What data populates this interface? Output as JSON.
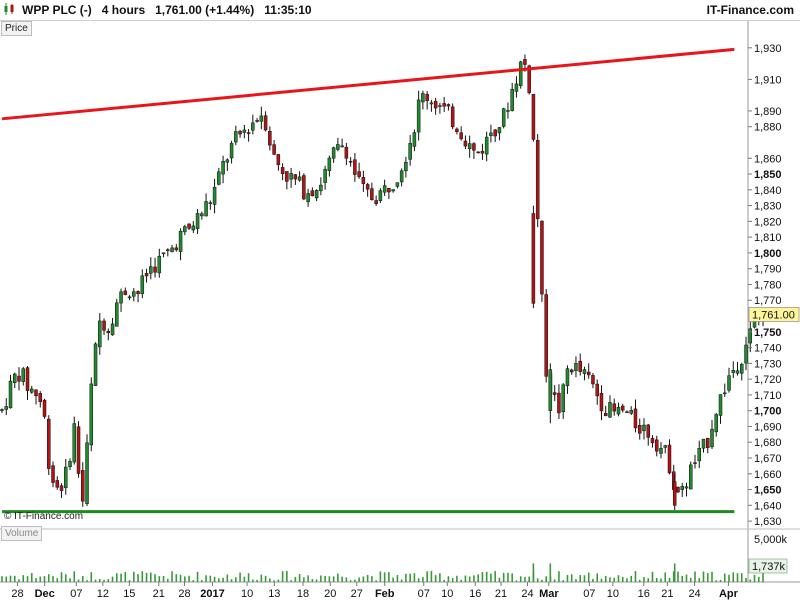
{
  "header": {
    "title": "WPP PLC (-)   4 hours   1,761.00 (+1.44%)   11:35:10",
    "brand": "IT-Finance.com"
  },
  "panels": {
    "price_label": "Price",
    "volume_label": "Volume",
    "watermark": "© IT-Finance.com"
  },
  "colors": {
    "up": "#1f8a2e",
    "down": "#b01515",
    "resistance": "#e8161a",
    "support": "#1f8a1f",
    "volume": "#3a9a3a",
    "last_tag_bg": "#fff59a"
  },
  "chart_data": {
    "type": "candlestick",
    "title": "WPP PLC (-)",
    "timeframe": "4 hours",
    "last_price": "1,761.00",
    "change": "+1.44%",
    "time": "11:35:10",
    "y_range": [
      1625,
      1947
    ],
    "y_ticks": [
      {
        "value": 1930,
        "label": "1,930",
        "bold": false
      },
      {
        "value": 1910,
        "label": "1,910",
        "bold": false
      },
      {
        "value": 1890,
        "label": "1,890",
        "bold": false
      },
      {
        "value": 1880,
        "label": "1,880",
        "bold": false
      },
      {
        "value": 1860,
        "label": "1,860",
        "bold": false
      },
      {
        "value": 1850,
        "label": "1,850",
        "bold": true
      },
      {
        "value": 1840,
        "label": "1,840",
        "bold": false
      },
      {
        "value": 1830,
        "label": "1,830",
        "bold": false
      },
      {
        "value": 1820,
        "label": "1,820",
        "bold": false
      },
      {
        "value": 1810,
        "label": "1,810",
        "bold": false
      },
      {
        "value": 1800,
        "label": "1,800",
        "bold": true
      },
      {
        "value": 1790,
        "label": "1,790",
        "bold": false
      },
      {
        "value": 1780,
        "label": "1,780",
        "bold": false
      },
      {
        "value": 1770,
        "label": "1,770",
        "bold": false
      },
      {
        "value": 1750,
        "label": "1,750",
        "bold": true
      },
      {
        "value": 1740,
        "label": "1,740",
        "bold": false
      },
      {
        "value": 1730,
        "label": "1,730",
        "bold": false
      },
      {
        "value": 1720,
        "label": "1,720",
        "bold": false
      },
      {
        "value": 1710,
        "label": "1,710",
        "bold": false
      },
      {
        "value": 1700,
        "label": "1,700",
        "bold": true
      },
      {
        "value": 1690,
        "label": "1,690",
        "bold": false
      },
      {
        "value": 1680,
        "label": "1,680",
        "bold": false
      },
      {
        "value": 1670,
        "label": "1,670",
        "bold": false
      },
      {
        "value": 1660,
        "label": "1,660",
        "bold": false
      },
      {
        "value": 1650,
        "label": "1,650",
        "bold": true
      },
      {
        "value": 1640,
        "label": "1,640",
        "bold": false
      },
      {
        "value": 1630,
        "label": "1,630",
        "bold": false
      }
    ],
    "last_price_tag": {
      "value": 1761,
      "label": "1,761.00"
    },
    "x_ticks": [
      {
        "label": "28",
        "bold": false
      },
      {
        "label": "Dec",
        "bold": true
      },
      {
        "label": "07",
        "bold": false
      },
      {
        "label": "12",
        "bold": false
      },
      {
        "label": "15",
        "bold": false
      },
      {
        "label": "21",
        "bold": false
      },
      {
        "label": "28",
        "bold": false
      },
      {
        "label": "2017",
        "bold": true
      },
      {
        "label": "10",
        "bold": false
      },
      {
        "label": "13",
        "bold": false
      },
      {
        "label": "18",
        "bold": false
      },
      {
        "label": "20",
        "bold": false
      },
      {
        "label": "27",
        "bold": false
      },
      {
        "label": "Feb",
        "bold": true
      },
      {
        "label": "07",
        "bold": false
      },
      {
        "label": "10",
        "bold": false
      },
      {
        "label": "16",
        "bold": false
      },
      {
        "label": "21",
        "bold": false
      },
      {
        "label": "24",
        "bold": false
      },
      {
        "label": "Mar",
        "bold": true
      },
      {
        "label": "07",
        "bold": false
      },
      {
        "label": "10",
        "bold": false
      },
      {
        "label": "16",
        "bold": false
      },
      {
        "label": "21",
        "bold": false
      },
      {
        "label": "24",
        "bold": false
      },
      {
        "label": "Apr",
        "bold": true
      }
    ],
    "x_tick_positions": [
      0.021,
      0.058,
      0.101,
      0.137,
      0.173,
      0.213,
      0.248,
      0.286,
      0.333,
      0.37,
      0.409,
      0.446,
      0.482,
      0.52,
      0.573,
      0.605,
      0.643,
      0.678,
      0.714,
      0.743,
      0.798,
      0.83,
      0.872,
      0.904,
      0.941,
      0.987
    ],
    "trendlines": [
      {
        "name": "resistance",
        "start": {
          "x": 0,
          "y": 1885
        },
        "end": {
          "x": 0.995,
          "y": 1929
        }
      },
      {
        "name": "support",
        "start": {
          "x": 0,
          "y": 1636
        },
        "end": {
          "x": 0.995,
          "y": 1636
        }
      }
    ],
    "volume": {
      "axis_labels": [
        "5,000k",
        "1,737k"
      ],
      "max_k": 10000,
      "last_k": 1737
    },
    "path_anchors": [
      [
        0.0,
        1700
      ],
      [
        0.015,
        1720
      ],
      [
        0.025,
        1725
      ],
      [
        0.035,
        1715
      ],
      [
        0.05,
        1710
      ],
      [
        0.06,
        1690
      ],
      [
        0.065,
        1660
      ],
      [
        0.075,
        1652
      ],
      [
        0.085,
        1655
      ],
      [
        0.095,
        1680
      ],
      [
        0.1,
        1695
      ],
      [
        0.106,
        1645
      ],
      [
        0.112,
        1642
      ],
      [
        0.118,
        1700
      ],
      [
        0.126,
        1735
      ],
      [
        0.134,
        1760
      ],
      [
        0.144,
        1752
      ],
      [
        0.155,
        1768
      ],
      [
        0.17,
        1778
      ],
      [
        0.185,
        1775
      ],
      [
        0.2,
        1790
      ],
      [
        0.214,
        1795
      ],
      [
        0.23,
        1802
      ],
      [
        0.24,
        1810
      ],
      [
        0.255,
        1815
      ],
      [
        0.27,
        1825
      ],
      [
        0.285,
        1835
      ],
      [
        0.3,
        1855
      ],
      [
        0.315,
        1870
      ],
      [
        0.33,
        1878
      ],
      [
        0.345,
        1885
      ],
      [
        0.355,
        1890
      ],
      [
        0.362,
        1875
      ],
      [
        0.37,
        1860
      ],
      [
        0.385,
        1850
      ],
      [
        0.4,
        1845
      ],
      [
        0.41,
        1840
      ],
      [
        0.43,
        1842
      ],
      [
        0.45,
        1862
      ],
      [
        0.465,
        1870
      ],
      [
        0.478,
        1852
      ],
      [
        0.492,
        1838
      ],
      [
        0.505,
        1835
      ],
      [
        0.52,
        1840
      ],
      [
        0.535,
        1848
      ],
      [
        0.548,
        1862
      ],
      [
        0.56,
        1880
      ],
      [
        0.568,
        1898
      ],
      [
        0.576,
        1900
      ],
      [
        0.59,
        1895
      ],
      [
        0.605,
        1888
      ],
      [
        0.62,
        1880
      ],
      [
        0.633,
        1870
      ],
      [
        0.643,
        1862
      ],
      [
        0.655,
        1868
      ],
      [
        0.665,
        1878
      ],
      [
        0.68,
        1884
      ],
      [
        0.695,
        1906
      ],
      [
        0.705,
        1920
      ],
      [
        0.714,
        1918
      ],
      [
        0.718,
        1897
      ],
      [
        0.725,
        1852
      ],
      [
        0.732,
        1780
      ],
      [
        0.74,
        1722
      ],
      [
        0.748,
        1710
      ],
      [
        0.758,
        1700
      ],
      [
        0.77,
        1730
      ],
      [
        0.785,
        1725
      ],
      [
        0.8,
        1718
      ],
      [
        0.815,
        1705
      ],
      [
        0.83,
        1698
      ],
      [
        0.845,
        1700
      ],
      [
        0.86,
        1692
      ],
      [
        0.875,
        1688
      ],
      [
        0.89,
        1680
      ],
      [
        0.905,
        1670
      ],
      [
        0.915,
        1650
      ],
      [
        0.925,
        1648
      ],
      [
        0.935,
        1662
      ],
      [
        0.948,
        1672
      ],
      [
        0.958,
        1680
      ],
      [
        0.968,
        1698
      ],
      [
        0.978,
        1710
      ],
      [
        0.988,
        1722
      ],
      [
        0.998,
        1730
      ],
      [
        1.005,
        1735
      ],
      [
        1.012,
        1745
      ],
      [
        1.02,
        1752
      ],
      [
        1.028,
        1758
      ],
      [
        1.034,
        1761
      ]
    ],
    "spike_candles": [
      {
        "t": 0.722,
        "open": 1825,
        "close": 1768,
        "high": 1830,
        "low": 1765
      },
      {
        "t": 0.745,
        "open": 1700,
        "close": 1726,
        "high": 1730,
        "low": 1692
      },
      {
        "t": 0.914,
        "open": 1655,
        "close": 1640,
        "high": 1660,
        "low": 1637
      }
    ],
    "bar_count": 180
  }
}
